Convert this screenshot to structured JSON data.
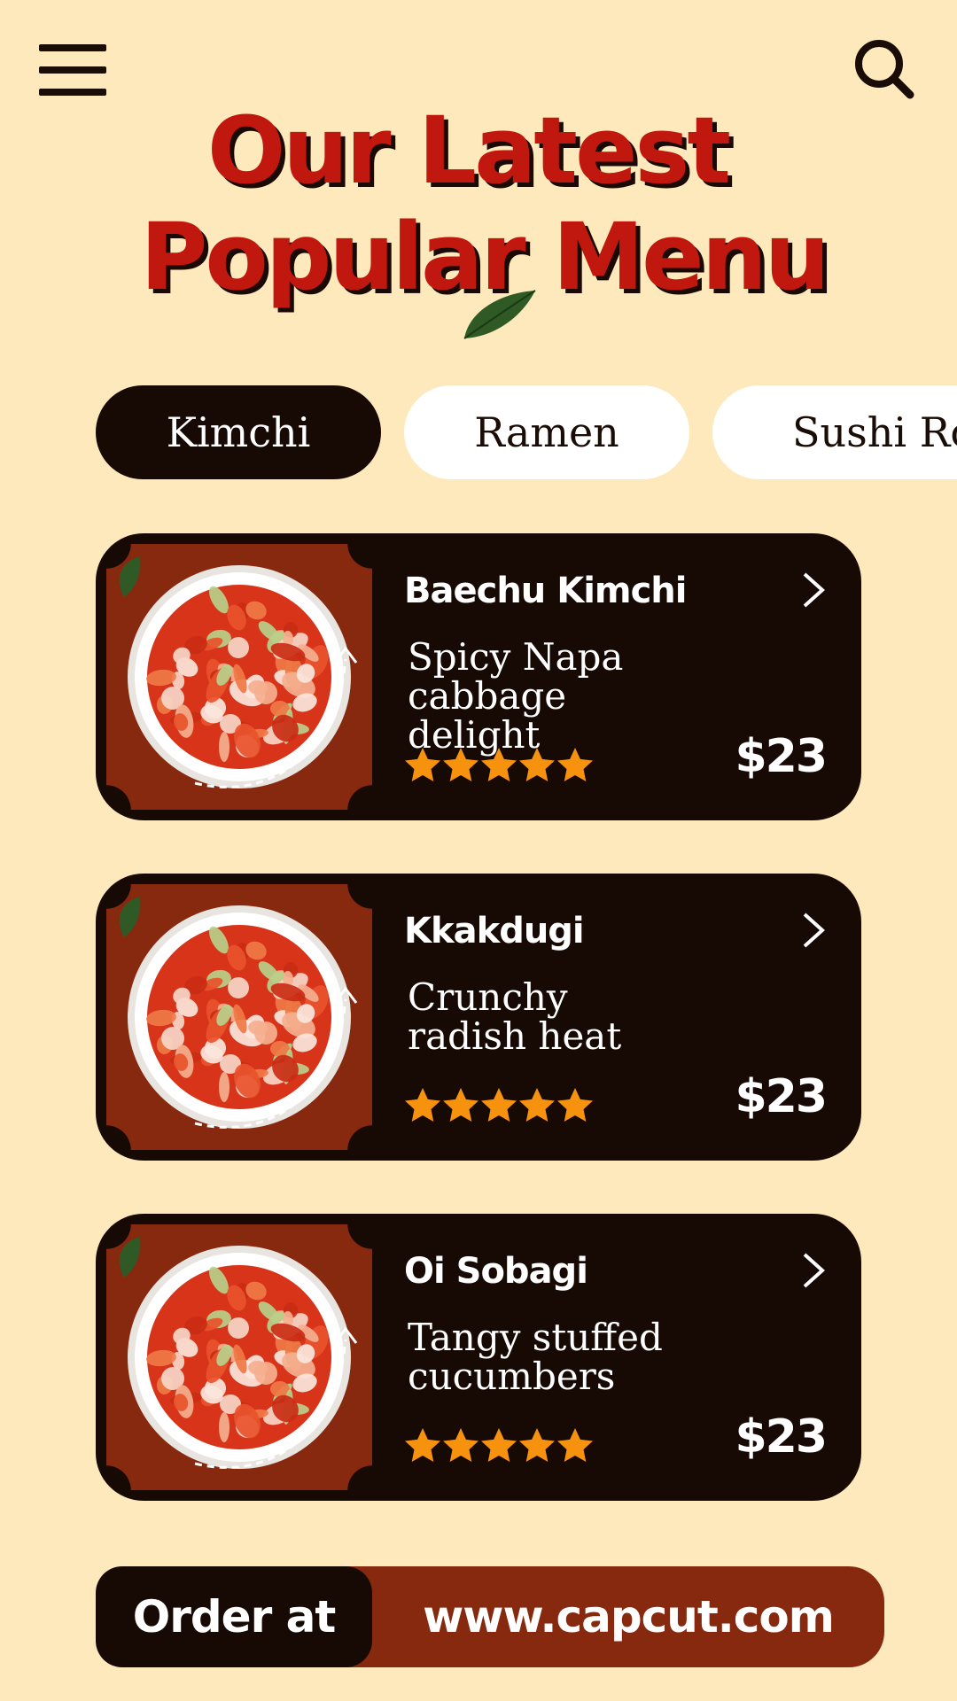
{
  "header": {
    "menu_icon": "hamburger-menu-icon",
    "search_icon": "search-icon",
    "title_line_1": "Our Latest",
    "title_line_2": "Popular Menu"
  },
  "tabs": [
    {
      "label": "Kimchi",
      "active": true
    },
    {
      "label": "Ramen",
      "active": false
    },
    {
      "label": "Sushi Ro",
      "active": false
    }
  ],
  "menu_items": [
    {
      "name": "Baechu Kimchi",
      "description": "Spicy Napa cabbage delight",
      "rating": 5,
      "price": "$23",
      "image": "kimchi-bowl-image"
    },
    {
      "name": "Kkakdugi",
      "description": "Crunchy radish heat",
      "rating": 5,
      "price": "$23",
      "image": "kimchi-bowl-image"
    },
    {
      "name": "Oi Sobagi",
      "description": "Tangy stuffed cucumbers",
      "rating": 5,
      "price": "$23",
      "image": "kimchi-bowl-image"
    }
  ],
  "order": {
    "label": "Order at",
    "url": "www.capcut.com"
  },
  "colors": {
    "background": "#fde9bb",
    "title_red": "#c0180f",
    "dark": "#170904",
    "rust": "#86290f",
    "star": "#f7920f"
  }
}
